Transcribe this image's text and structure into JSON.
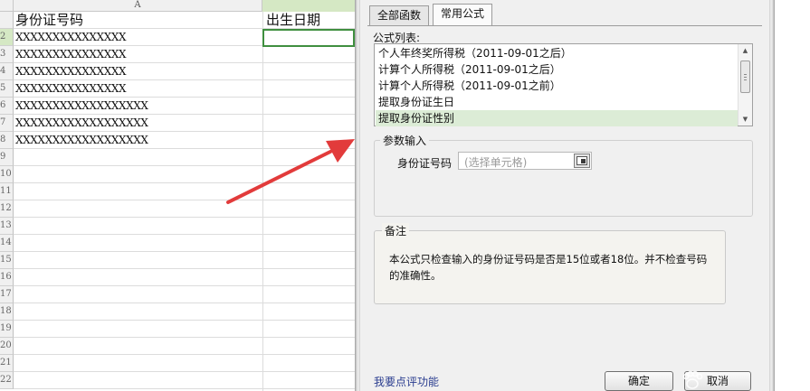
{
  "sheet": {
    "column_a_label": "A",
    "rows": [
      "",
      "2",
      "3",
      "4",
      "5",
      "6",
      "7",
      "8",
      "9",
      "10",
      "11",
      "12",
      "13",
      "14",
      "15",
      "16",
      "17",
      "18",
      "19",
      "20",
      "21",
      "22"
    ],
    "header_id": "身份证号码",
    "header_birth": "出生日期",
    "id_values": [
      "XXXXXXXXXXXXXXX",
      "XXXXXXXXXXXXXXX",
      "XXXXXXXXXXXXXXX",
      "XXXXXXXXXXXXXXX",
      "XXXXXXXXXXXXXXXXXX",
      "XXXXXXXXXXXXXXXXXX",
      "XXXXXXXXXXXXXXXXXX"
    ]
  },
  "dialog": {
    "tabs": [
      "全部函数",
      "常用公式"
    ],
    "active_tab": 1,
    "formula_list_label": "公式列表:",
    "formulas": [
      "个人年终奖所得税（2011-09-01之后）",
      "计算个人所得税（2011-09-01之后）",
      "计算个人所得税（2011-09-01之前）",
      "提取身份证生日",
      "提取身份证性别"
    ],
    "selected_formula": 4,
    "params_title": "参数输入",
    "param_label": "身份证号码",
    "param_placeholder": "(选择单元格)",
    "note_title": "备注",
    "note_text": "本公式只检查输入的身份证号码是否是15位或者18位。并不检查号码的准确性。",
    "feedback_link": "我要点评功能",
    "ok_label": "确定",
    "cancel_label": "取消"
  },
  "colors": {
    "selection_green": "#3f8f3f",
    "arrow_red": "#e23b3b",
    "list_selected": "#dcecd6"
  }
}
